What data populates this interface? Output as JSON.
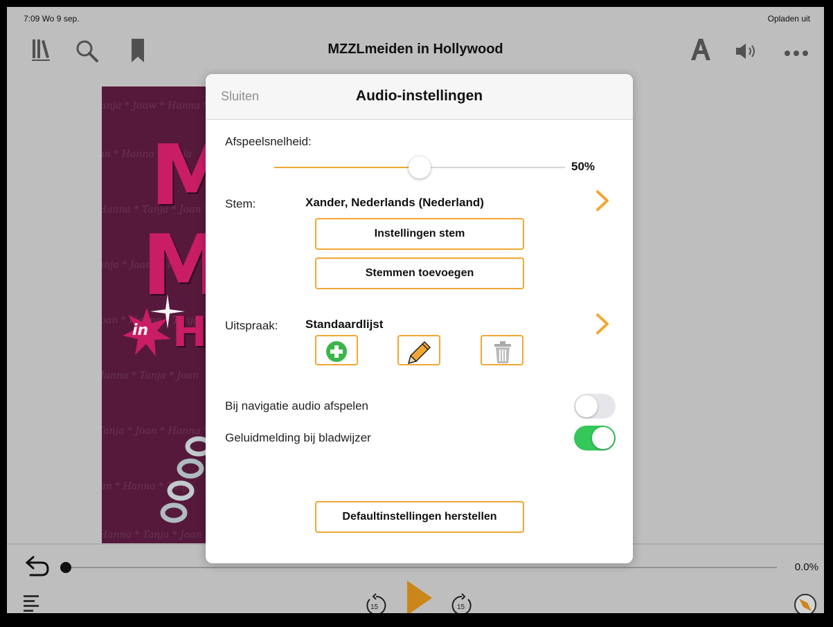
{
  "statusbar": {
    "left": "7:09  Wo 9 sep.",
    "right": "Opladen uit"
  },
  "topbar": {
    "title": "MZZLmeiden in Hollywood"
  },
  "progress": {
    "percent_label": "0.0%"
  },
  "dialog": {
    "close_label": "Sluiten",
    "title": "Audio-instellingen",
    "speed": {
      "label": "Afspeelsnelheid:",
      "value": 50,
      "value_label": "50%"
    },
    "voice": {
      "label": "Stem:",
      "value": "Xander, Nederlands (Nederland)"
    },
    "voice_settings_button": "Instellingen stem",
    "add_voices_button": "Stemmen toevoegen",
    "pronunciation": {
      "label": "Uitspraak:",
      "value": "Standaardlijst"
    },
    "toggles": [
      {
        "label": "Bij navigatie audio afspelen",
        "on": false
      },
      {
        "label": "Geluidmelding bij bladwijzer",
        "on": true
      }
    ],
    "reset_button": "Defaultinstellingen herstellen"
  },
  "colors": {
    "accent": "#f2a733",
    "toggle_on": "#34c759",
    "toggle_off": "#e5e5ea",
    "add_green": "#3cb54a"
  },
  "icons": {
    "toolbar_left": [
      "library-icon",
      "search-icon",
      "bookmark-icon"
    ],
    "toolbar_right": [
      "font-icon",
      "speaker-icon",
      "more-icon"
    ],
    "bottom": [
      "back-icon",
      "toc-icon",
      "rewind-15-icon",
      "play-icon",
      "forward-15-icon",
      "compass-icon"
    ]
  }
}
